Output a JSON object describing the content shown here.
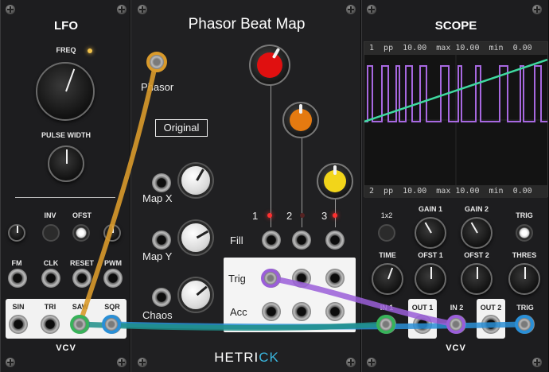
{
  "lfo": {
    "title": "LFO",
    "freq_label": "FREQ",
    "pulse_width_label": "PULSE WIDTH",
    "inv_label": "INV",
    "ofst_label": "OFST",
    "fm_label": "FM",
    "clk_label": "CLK",
    "reset_label": "RESET",
    "pwm_label": "PWM",
    "sin_label": "SIN",
    "tri_label": "TRI",
    "saw_label": "SAW",
    "sqr_label": "SQR",
    "logo": "VCV"
  },
  "phasor": {
    "title": "Phasor Beat Map",
    "phasor_label": "Phasor",
    "original_button": "Original",
    "map_x_label": "Map X",
    "map_y_label": "Map Y",
    "chaos_label": "Chaos",
    "ch1_label": "1",
    "ch2_label": "2",
    "ch3_label": "3",
    "fill_label": "Fill",
    "trig_label": "Trig",
    "acc_label": "Acc",
    "brand_a": "HETRI",
    "brand_b": "CK",
    "knob_colors": [
      "#e01010",
      "#e57a10",
      "#f2d51a"
    ]
  },
  "scope": {
    "title": "SCOPE",
    "bar1": "1  pp  10.00  max 10.00  min  0.00",
    "bar2": "2  pp  10.00  max 10.00  min  0.00",
    "x2_label": "1x2",
    "gain1_label": "GAIN 1",
    "gain2_label": "GAIN 2",
    "trig_label": "TRIG",
    "time_label": "TIME",
    "ofst1_label": "OFST 1",
    "ofst2_label": "OFST 2",
    "thres_label": "THRES",
    "in1_label": "IN 1",
    "out1_label": "OUT 1",
    "in2_label": "IN 2",
    "out2_label": "OUT 2",
    "trig_out_label": "TRIG",
    "logo": "VCV",
    "trace1_color": "#3fd9a0",
    "trace2_color": "#a768e0"
  },
  "cables": {
    "orange": "#d99a2b",
    "blue": "#2a8fd6",
    "teal": "#1f8f8a",
    "purple": "#9a5ed8",
    "green": "#38b25a"
  }
}
